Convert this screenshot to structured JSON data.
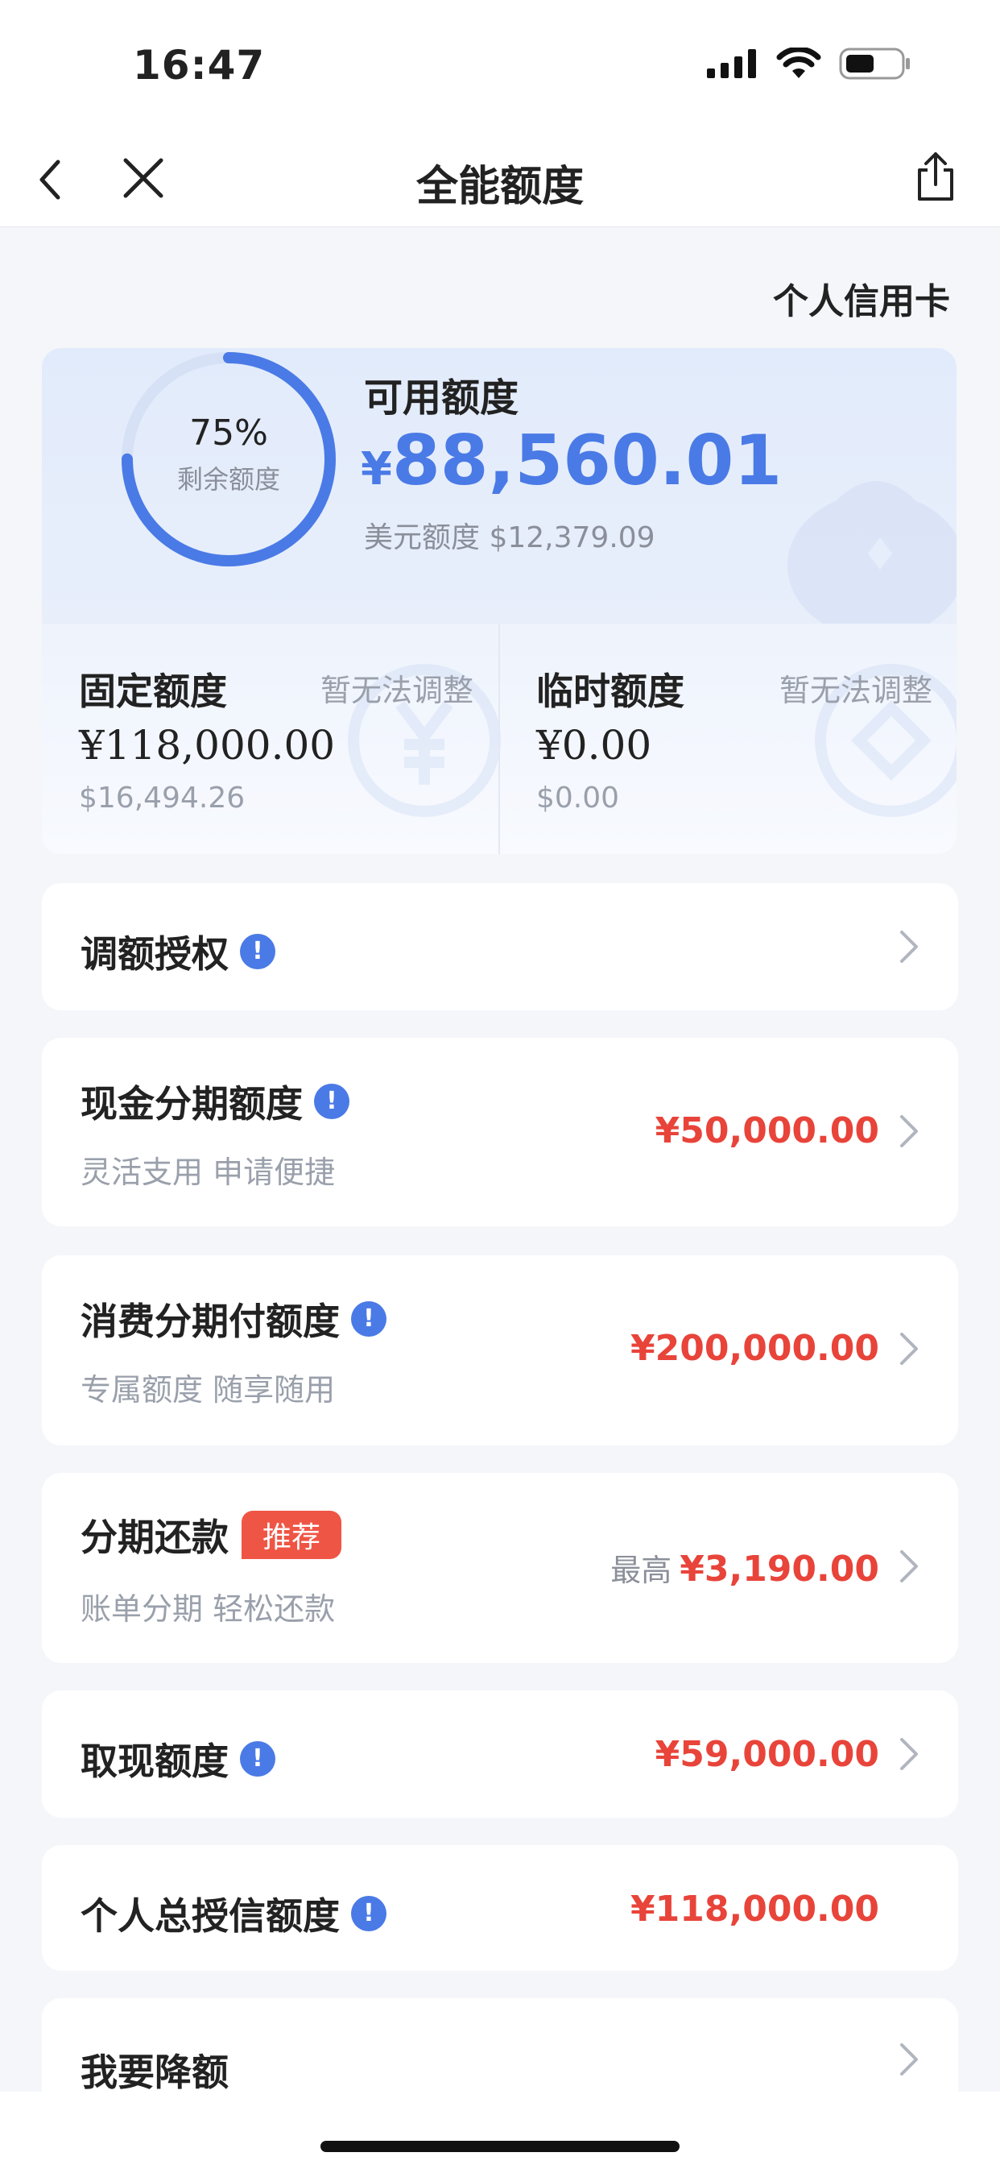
{
  "status_bar": {
    "time": "16:47"
  },
  "nav": {
    "title": "全能额度",
    "back_icon": "chevron-left-icon",
    "close_icon": "close-icon",
    "share_icon": "share-icon"
  },
  "card_type": "个人信用卡",
  "summary": {
    "ring_percent": "75%",
    "ring_percent_value": 0.75,
    "ring_label": "剩余额度",
    "available_label": "可用额度",
    "available_currency": "¥",
    "available_amount": "88,560.01",
    "usd_label": "美元额度",
    "usd_amount": "$12,379.09",
    "accent_color": "#4a7ae6"
  },
  "fixed_quota": {
    "title": "固定额度",
    "note": "暂无法调整",
    "amount": "¥118,000.00",
    "usd": "$16,494.26"
  },
  "temp_quota": {
    "title": "临时额度",
    "note": "暂无法调整",
    "amount": "¥0.00",
    "usd": "$0.00"
  },
  "rows": {
    "adjust_auth": {
      "title": "调额授权"
    },
    "cash_installment": {
      "title": "现金分期额度",
      "sub": "灵活支用 申请便捷",
      "amount": "¥50,000.00"
    },
    "consumer_installment": {
      "title": "消费分期付额度",
      "sub": "专属额度 随享随用",
      "amount": "¥200,000.00"
    },
    "installment_repay": {
      "title": "分期还款",
      "badge": "推荐",
      "sub": "账单分期 轻松还款",
      "max_prefix": "最高",
      "amount": "¥3,190.00"
    },
    "cash_withdraw": {
      "title": "取现额度",
      "amount": "¥59,000.00"
    },
    "total_credit": {
      "title": "个人总授信额度",
      "amount": "¥118,000.00"
    },
    "reduce_limit": {
      "title": "我要降额"
    }
  },
  "info_glyph": "!",
  "amount_color": "#e8443a"
}
